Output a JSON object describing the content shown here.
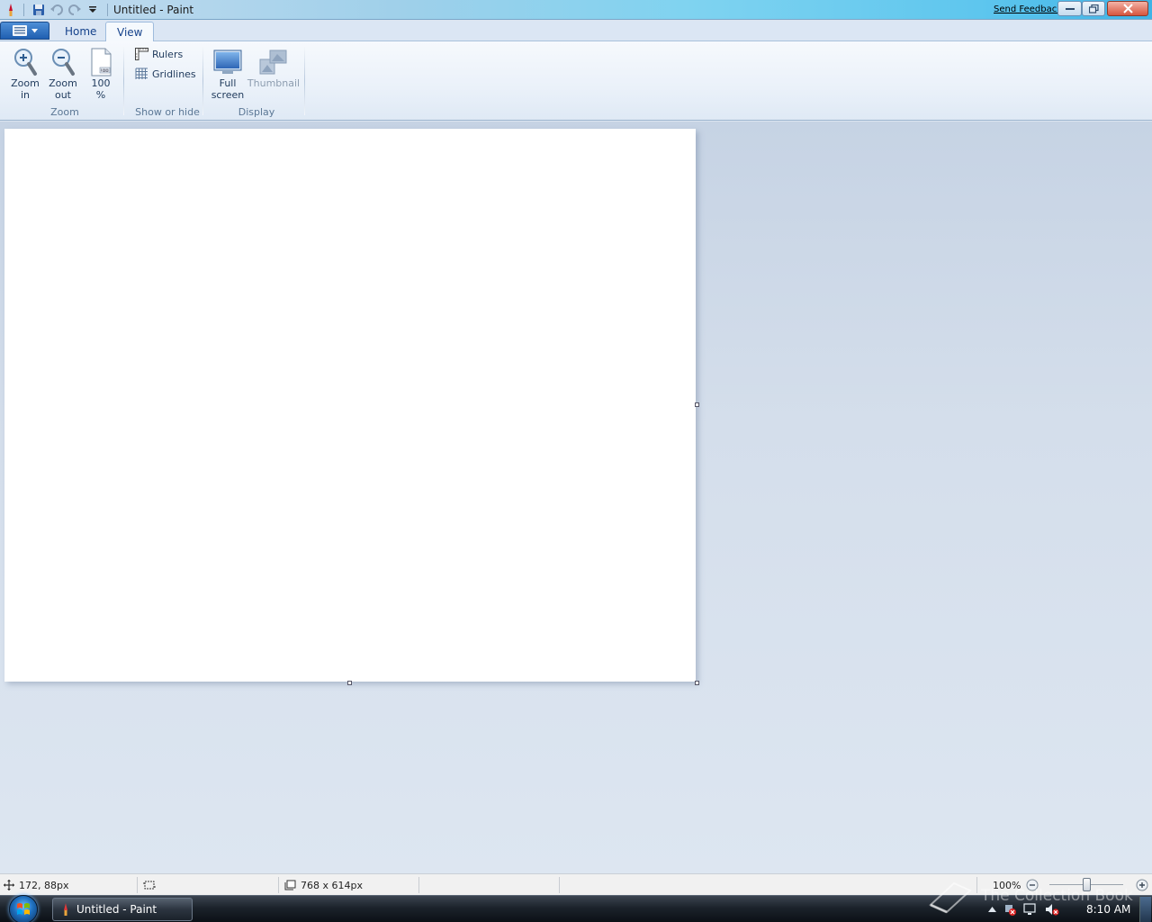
{
  "window": {
    "title": "Untitled - Paint",
    "send_feedback": "Send Feedback"
  },
  "tabs": [
    {
      "label": "Home"
    },
    {
      "label": "View"
    }
  ],
  "ribbon": {
    "zoom": {
      "group_label": "Zoom",
      "zoom_in": {
        "line1": "Zoom",
        "line2": "in"
      },
      "zoom_out": {
        "line1": "Zoom",
        "line2": "out"
      },
      "hundred": {
        "line1": "100",
        "line2": "%"
      }
    },
    "show_hide": {
      "group_label": "Show or hide",
      "rulers": "Rulers",
      "gridlines": "Gridlines"
    },
    "display": {
      "group_label": "Display",
      "full_screen": {
        "line1": "Full",
        "line2": "screen"
      },
      "thumbnail": "Thumbnail"
    }
  },
  "status": {
    "cursor": "172, 88px",
    "size": "768 x 614px",
    "zoom": "100%"
  },
  "taskbar": {
    "task_label": "Untitled - Paint",
    "clock": "8:10 AM"
  },
  "watermark": "The Collection Book",
  "colors": {
    "accent": "#1f5fb1",
    "workspace": "#d4deeb",
    "canvas": "#ffffff"
  }
}
